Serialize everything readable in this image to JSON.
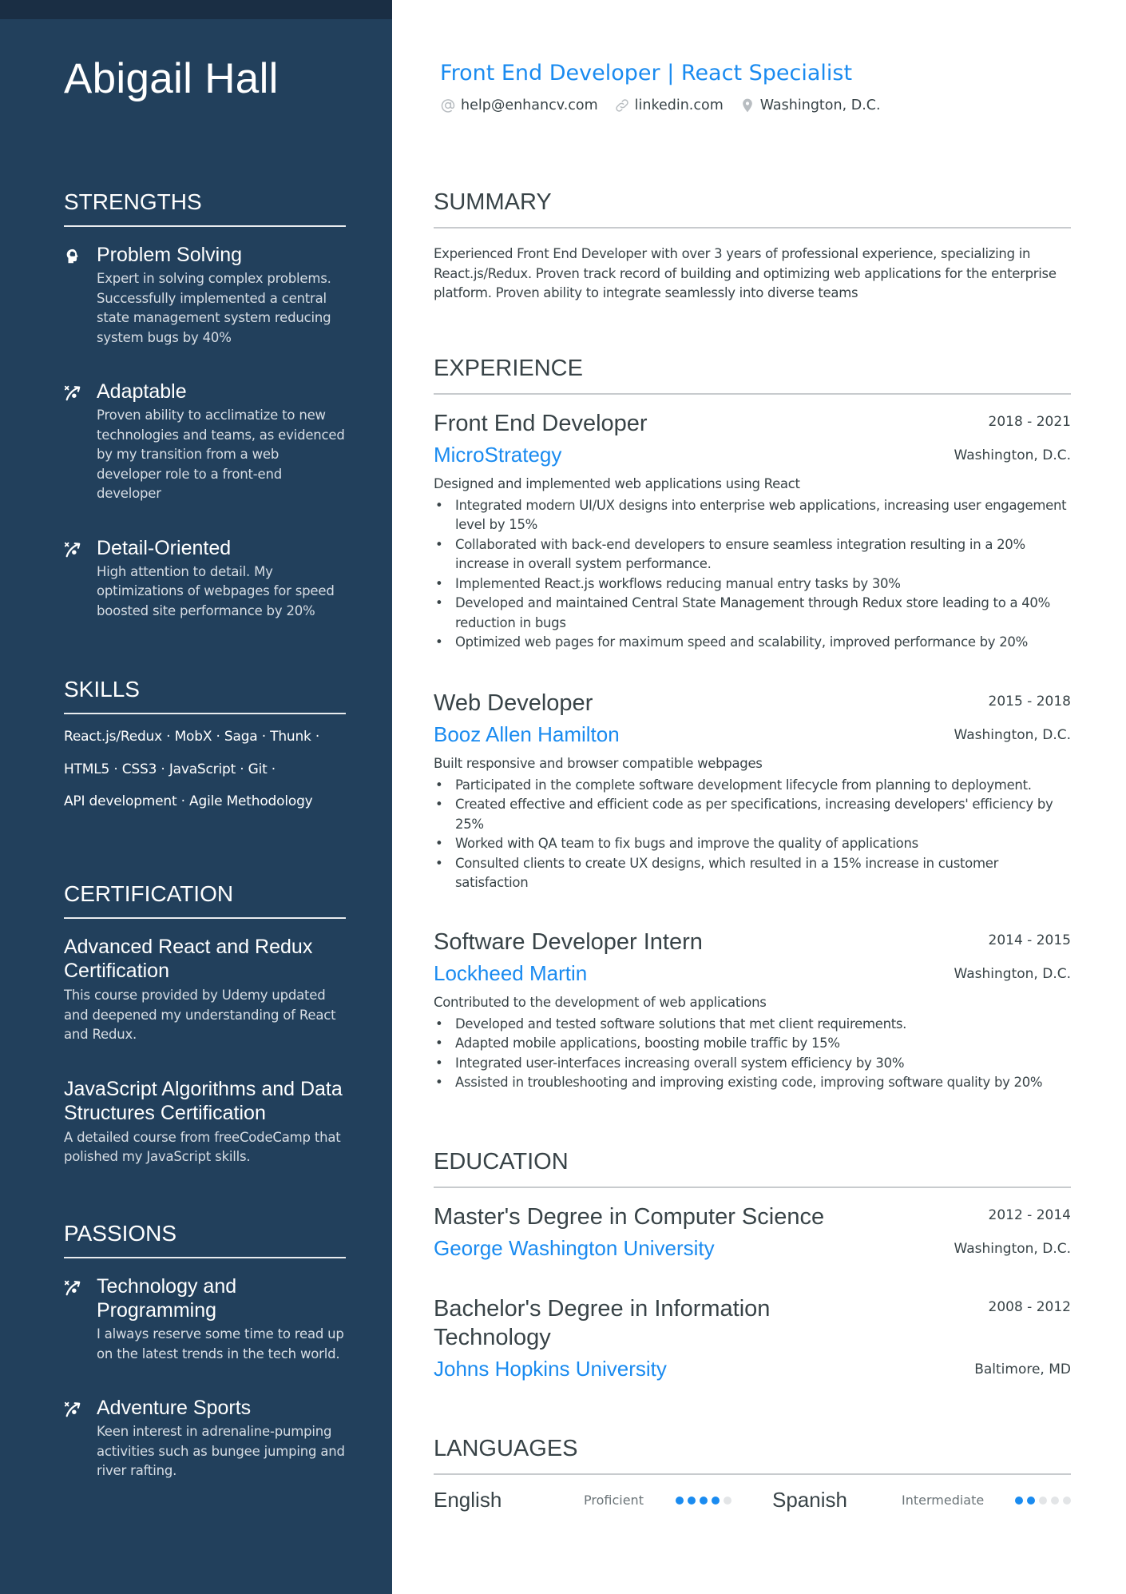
{
  "header": {
    "name": "Abigail Hall",
    "headline": "Front End Developer | React Specialist",
    "contacts": [
      {
        "icon": "at-icon",
        "text": "help@enhancv.com"
      },
      {
        "icon": "link-icon",
        "text": "linkedin.com"
      },
      {
        "icon": "location-pin-icon",
        "text": "Washington, D.C."
      }
    ]
  },
  "colors": {
    "sidebar_bg": "#22405c",
    "sidebar_topband": "#1a2e44",
    "accent": "#1a8bf0",
    "text": "#384347"
  },
  "sidebar": {
    "strengths": {
      "heading": "STRENGTHS",
      "items": [
        {
          "icon": "brain-head-icon",
          "title": "Problem Solving",
          "desc": "Expert in solving complex problems. Successfully implemented a central state management system reducing system bugs by 40%"
        },
        {
          "icon": "trajectory-icon",
          "title": "Adaptable",
          "desc": "Proven ability to acclimatize to new technologies and teams, as evidenced by my transition from a web developer role to a front-end developer"
        },
        {
          "icon": "trajectory-icon",
          "title": "Detail-Oriented",
          "desc": "High attention to detail. My optimizations of webpages for speed boosted site performance by 20%"
        }
      ]
    },
    "skills": {
      "heading": "SKILLS",
      "lines": [
        "React.js/Redux · MobX · Saga · Thunk ·",
        "HTML5 · CSS3 · JavaScript · Git  ·",
        "API development · Agile Methodology"
      ]
    },
    "certification": {
      "heading": "CERTIFICATION",
      "items": [
        {
          "title": "Advanced React and Redux Certification",
          "desc": "This course provided by Udemy updated and deepened my understanding of React and Redux."
        },
        {
          "title": "JavaScript Algorithms and Data Structures Certification",
          "desc": "A detailed course from freeCodeCamp that polished my JavaScript skills."
        }
      ]
    },
    "passions": {
      "heading": "PASSIONS",
      "items": [
        {
          "icon": "trajectory-icon",
          "title": "Technology and Programming",
          "desc": "I always reserve some time to read up on the latest trends in the tech world."
        },
        {
          "icon": "trajectory-icon",
          "title": "Adventure Sports",
          "desc": "Keen interest in adrenaline-pumping activities such as bungee jumping and river rafting."
        }
      ]
    }
  },
  "summary": {
    "heading": "SUMMARY",
    "text": "Experienced Front End Developer with over 3 years of professional experience, specializing in React.js/Redux. Proven track record of building and optimizing web applications for the enterprise platform. Proven ability to integrate seamlessly into diverse teams"
  },
  "experience": {
    "heading": "EXPERIENCE",
    "items": [
      {
        "title": "Front End Developer",
        "dates": "2018 - 2021",
        "company": "MicroStrategy",
        "location": "Washington, D.C.",
        "desc": "Designed and implemented web applications using React",
        "bullets": [
          "Integrated modern UI/UX designs into enterprise web applications, increasing user engagement level by 15%",
          "Collaborated with back-end developers to ensure seamless integration resulting in a 20% increase in overall system performance.",
          "Implemented React.js workflows reducing manual entry tasks by 30%",
          "Developed and maintained Central State Management through Redux store leading to a 40% reduction in bugs",
          "Optimized web pages for maximum speed and scalability, improved performance by 20%"
        ]
      },
      {
        "title": "Web Developer",
        "dates": "2015 - 2018",
        "company": "Booz Allen Hamilton",
        "location": "Washington, D.C.",
        "desc": "Built responsive and browser compatible webpages",
        "bullets": [
          "Participated in the complete software development lifecycle from planning to deployment.",
          "Created effective and efficient code as per specifications, increasing developers' efficiency by 25%",
          "Worked with QA team to fix bugs and improve the quality of applications",
          "Consulted clients to create UX designs, which resulted in a 15% increase in customer satisfaction"
        ]
      },
      {
        "title": "Software Developer Intern",
        "dates": "2014 - 2015",
        "company": "Lockheed Martin",
        "location": "Washington, D.C.",
        "desc": "Contributed to the development of web applications",
        "bullets": [
          "Developed and tested software solutions that met client requirements.",
          "Adapted mobile applications, boosting mobile traffic by 15%",
          "Integrated user-interfaces increasing overall system efficiency by 30%",
          "Assisted in troubleshooting and improving existing code, improving software quality by 20%"
        ]
      }
    ]
  },
  "education": {
    "heading": "EDUCATION",
    "items": [
      {
        "degree": "Master's Degree in Computer Science",
        "dates": "2012 - 2014",
        "school": "George Washington University",
        "location": "Washington, D.C."
      },
      {
        "degree": "Bachelor's Degree in Information Technology",
        "dates": "2008 - 2012",
        "school": "Johns Hopkins University",
        "location": "Baltimore, MD"
      }
    ]
  },
  "languages": {
    "heading": "LANGUAGES",
    "items": [
      {
        "name": "English",
        "level": "Proficient",
        "rating": 4,
        "max": 5
      },
      {
        "name": "Spanish",
        "level": "Intermediate",
        "rating": 2,
        "max": 5
      }
    ]
  }
}
